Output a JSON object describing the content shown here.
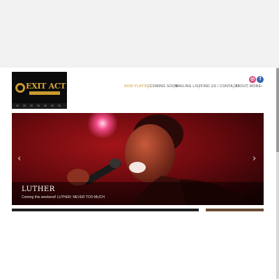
{
  "brand": {
    "logo_text": "EXIT ACT"
  },
  "social": [
    {
      "name": "instagram-icon",
      "glyph": "◎",
      "color": "#d6447a"
    },
    {
      "name": "facebook-icon",
      "glyph": "f",
      "color": "#3b63b3"
    }
  ],
  "nav": {
    "items": [
      {
        "label": "NOW PLAYING",
        "active": true
      },
      {
        "label": "COMING SOON",
        "active": false
      },
      {
        "label": "MAILING LIST",
        "active": false
      },
      {
        "label": "FIND US / CONTACT",
        "active": false
      },
      {
        "label": "ABOUT",
        "active": false
      },
      {
        "label": "MORE",
        "active": false
      }
    ],
    "more_chevron": "⌄"
  },
  "slider": {
    "title": "LUTHER",
    "subtitle": "Coming this weekend! LUTHER: NEVER TOO MUCH",
    "prev_glyph": "‹",
    "next_glyph": "›"
  },
  "colors": {
    "accent": "#c99a2e",
    "page_bg": "#f2f2f2",
    "slider_bg": "#3d0508"
  }
}
